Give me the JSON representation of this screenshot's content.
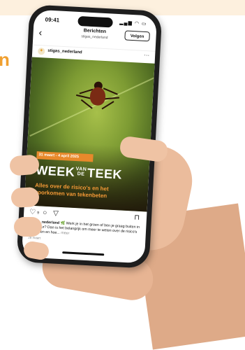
{
  "status": {
    "time": "09:41",
    "icons": "▂▄▆ ◠ ▭"
  },
  "nav": {
    "title": "Berichten",
    "subtitle": "stigas_nederland",
    "follow_label": "Volgen",
    "back": "‹"
  },
  "post": {
    "username": "stigas_nederland",
    "more": "···",
    "image": {
      "date": "31 maart - 4 april 2025",
      "title_a": "WEEK",
      "title_small_1": "VAN",
      "title_small_2": "DE",
      "title_b": "TEEK",
      "subtitle": "Alles over de risico's en het voorkomen van tekenbeten"
    },
    "likes": "9",
    "caption_user": "stigas_nederland",
    "caption_text": " 🌿 Werk je in het groen of ben je graag buiten in de natuur? Dan is het belangrijk om meer te weten over de risico's van teken en hoe...",
    "caption_more": " meer",
    "date": "28 maart"
  },
  "side_letter": "n",
  "colors": {
    "accent": "#e8892b",
    "background_band": "#fdf0de"
  }
}
